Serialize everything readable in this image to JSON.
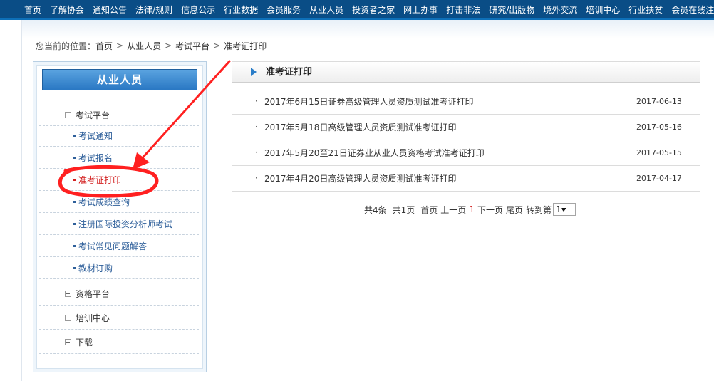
{
  "topnav": {
    "items": [
      "首页",
      "了解协会",
      "通知公告",
      "法律/规则",
      "信息公示",
      "行业数据",
      "会员服务",
      "从业人员",
      "投资者之家",
      "网上办事",
      "打击非法",
      "研究/出版物",
      "境外交流",
      "培训中心",
      "行业扶贫",
      "会员在线注册"
    ]
  },
  "breadcrumb": {
    "prefix": "您当前的位置：",
    "items": [
      "首页",
      "从业人员",
      "考试平台",
      "准考证打印"
    ],
    "separator": ">"
  },
  "sidebar": {
    "title": "从业人员",
    "categories": [
      {
        "label": "考试平台",
        "expanded": true
      },
      {
        "label": "资格平台",
        "expanded": false
      },
      {
        "label": "培训中心",
        "expanded": true
      },
      {
        "label": "下载",
        "expanded": true
      }
    ],
    "exam_items": [
      "考试通知",
      "考试报名",
      "准考证打印",
      "考试成绩查询",
      "注册国际投资分析师考试",
      "考试常见问题解答",
      "教材订购"
    ],
    "active_item": "准考证打印"
  },
  "content": {
    "section_title": "准考证打印",
    "bullet": "·",
    "list": [
      {
        "title": "2017年6月15日证券高级管理人员资质测试准考证打印",
        "date": "2017-06-13"
      },
      {
        "title": "2017年5月18日高级管理人员资质测试准考证打印",
        "date": "2017-05-16"
      },
      {
        "title": "2017年5月20至21日证券业从业人员资格考试准考证打印",
        "date": "2017-05-15"
      },
      {
        "title": "2017年4月20日高级管理人员资质测试准考证打印",
        "date": "2017-04-17"
      }
    ]
  },
  "pagination": {
    "total_items": "共4条",
    "total_pages": "共1页",
    "first": "首页",
    "prev": "上一页",
    "current": "1",
    "next": "下一页",
    "last": "尾页",
    "goto": "转到第",
    "select_value": "1"
  },
  "colors": {
    "nav_bg": "#0a4d86",
    "active_red": "#d32020",
    "link_blue": "#2e5f9a",
    "annotation_red": "#ff2020"
  }
}
